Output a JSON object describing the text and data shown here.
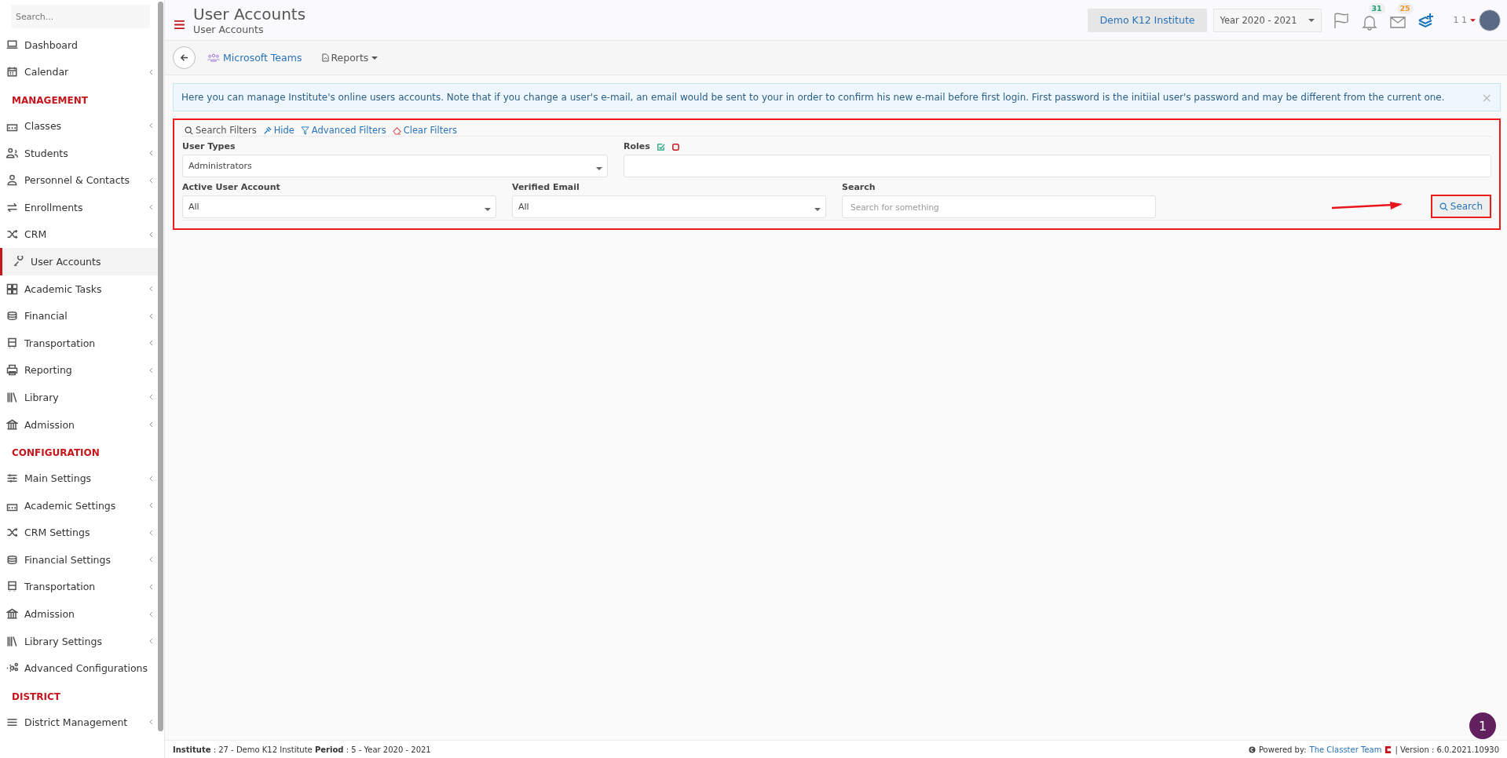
{
  "sidebar": {
    "search": {
      "placeholder": "Search..."
    },
    "items": [
      {
        "kind": "item",
        "label": "Dashboard",
        "submenu": false,
        "selected": false
      },
      {
        "kind": "item",
        "label": "Calendar",
        "submenu": true,
        "selected": false
      },
      {
        "kind": "heading",
        "label": "MANAGEMENT"
      },
      {
        "kind": "item",
        "label": "Classes",
        "submenu": true,
        "selected": false
      },
      {
        "kind": "item",
        "label": "Students",
        "submenu": true,
        "selected": false
      },
      {
        "kind": "item",
        "label": "Personnel & Contacts",
        "submenu": true,
        "selected": false
      },
      {
        "kind": "item",
        "label": "Enrollments",
        "submenu": true,
        "selected": false
      },
      {
        "kind": "item",
        "label": "CRM",
        "submenu": true,
        "selected": false
      },
      {
        "kind": "item",
        "label": "User Accounts",
        "submenu": false,
        "selected": true
      },
      {
        "kind": "item",
        "label": "Academic Tasks",
        "submenu": true,
        "selected": false
      },
      {
        "kind": "item",
        "label": "Financial",
        "submenu": true,
        "selected": false
      },
      {
        "kind": "item",
        "label": "Transportation",
        "submenu": true,
        "selected": false
      },
      {
        "kind": "item",
        "label": "Reporting",
        "submenu": true,
        "selected": false
      },
      {
        "kind": "item",
        "label": "Library",
        "submenu": true,
        "selected": false
      },
      {
        "kind": "item",
        "label": "Admission",
        "submenu": true,
        "selected": false
      },
      {
        "kind": "heading",
        "label": "CONFIGURATION"
      },
      {
        "kind": "item",
        "label": "Main Settings",
        "submenu": true,
        "selected": false
      },
      {
        "kind": "item",
        "label": "Academic Settings",
        "submenu": true,
        "selected": false
      },
      {
        "kind": "item",
        "label": "CRM Settings",
        "submenu": true,
        "selected": false
      },
      {
        "kind": "item",
        "label": "Financial Settings",
        "submenu": true,
        "selected": false
      },
      {
        "kind": "item",
        "label": "Transportation",
        "submenu": true,
        "selected": false
      },
      {
        "kind": "item",
        "label": "Admission",
        "submenu": true,
        "selected": false
      },
      {
        "kind": "item",
        "label": "Library Settings",
        "submenu": true,
        "selected": false
      },
      {
        "kind": "item",
        "label": "Advanced Configurations",
        "submenu": false,
        "selected": false
      },
      {
        "kind": "heading",
        "label": "DISTRICT"
      },
      {
        "kind": "item",
        "label": "District Management",
        "submenu": true,
        "selected": false
      }
    ]
  },
  "header": {
    "title": "User Accounts",
    "subtitle": "User Accounts",
    "institute": "Demo K12 Institute",
    "year": "Year 2020 - 2021",
    "notifications": "31",
    "messages": "25",
    "user": "1 1"
  },
  "toolbar": {
    "teams": "Microsoft Teams",
    "reports": "Reports"
  },
  "notice": {
    "text": "Here you can manage Institute's online users accounts. Note that if you change a user's e-mail, an email would be sent to your in order to confirm his new e-mail before first login. First password is the initiial user's password and may be different from the current one.",
    "close": "×"
  },
  "filters": {
    "actions": [
      {
        "kind": "title",
        "label": "Search Filters"
      },
      {
        "kind": "hide",
        "label": "Hide"
      },
      {
        "kind": "advanced",
        "label": "Advanced Filters"
      },
      {
        "kind": "clear",
        "label": "Clear Filters"
      }
    ],
    "user_types": {
      "label": "User Types",
      "value": "Administrators"
    },
    "roles": {
      "label": "Roles"
    },
    "active_account": {
      "label": "Active User Account",
      "value": "All"
    },
    "verified_email": {
      "label": "Verified Email",
      "value": "All"
    },
    "search": {
      "label": "Search",
      "placeholder": "Search for something"
    },
    "button": "Search"
  },
  "footer": {
    "info": "**Institute** : 27 - Demo K12 Institute **Period** : 5 - Year 2020 - 2021",
    "powered": "Powered by:",
    "link": "The Classter Team",
    "version": "| Version : 6.0.2021.10930"
  },
  "help_badge": "1"
}
